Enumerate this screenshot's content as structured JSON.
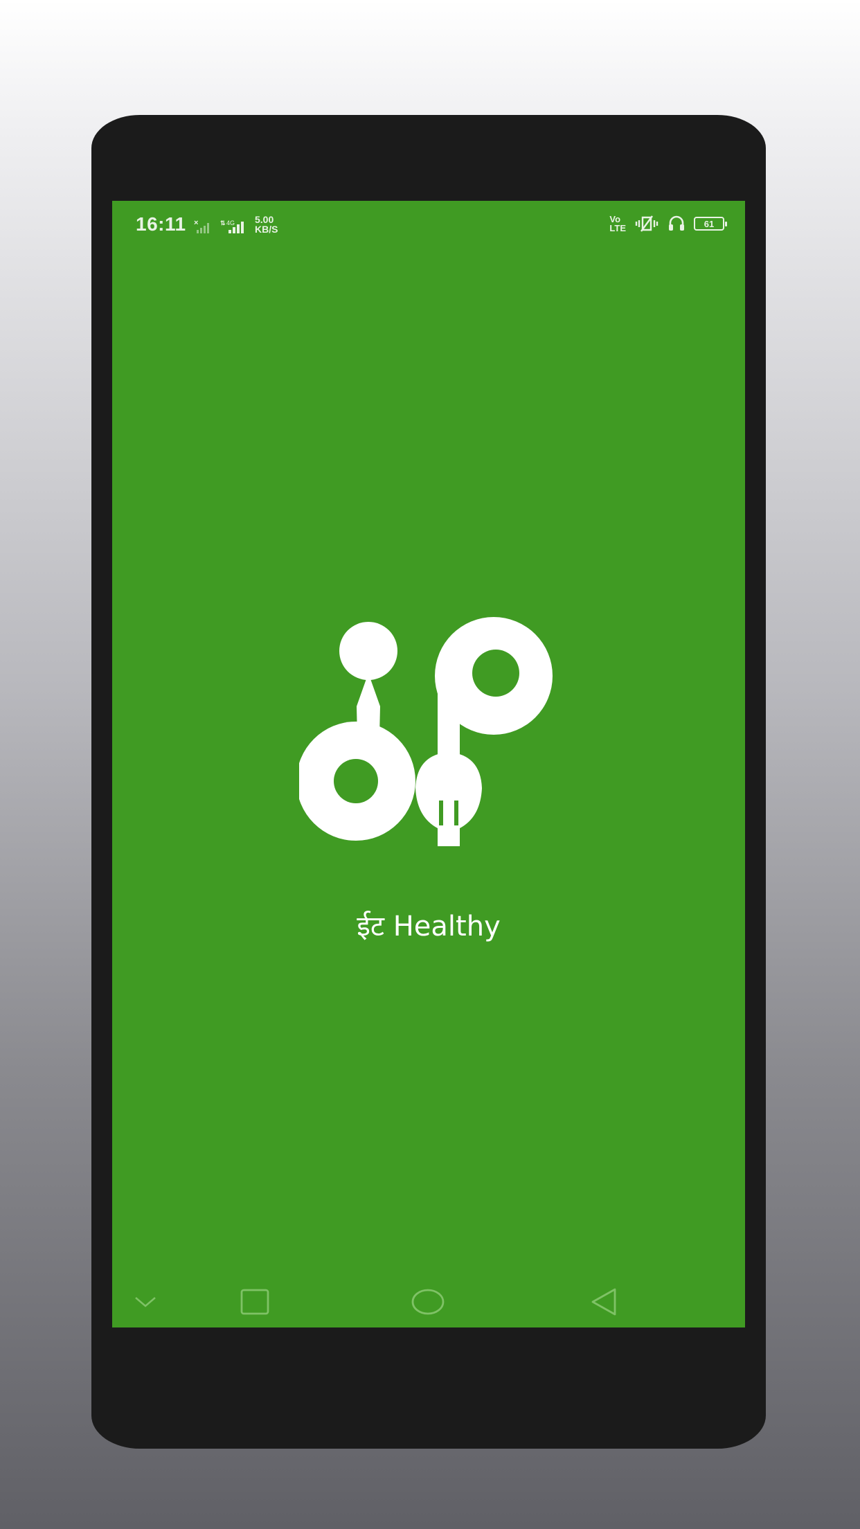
{
  "status_bar": {
    "time": "16:11",
    "net_speed_value": "5.00",
    "net_speed_unit": "KB/S",
    "network_type": "4G",
    "volte_top": "Vo",
    "volte_bottom": "LTE",
    "battery_level": "61"
  },
  "splash": {
    "tagline": "ईट Healthy"
  },
  "navigation": {
    "buttons": [
      "collapse",
      "recent-apps",
      "home",
      "back"
    ]
  },
  "colors": {
    "screen_background": "#409b23",
    "logo": "#ffffff",
    "phone_body": "#1b1b1b"
  }
}
